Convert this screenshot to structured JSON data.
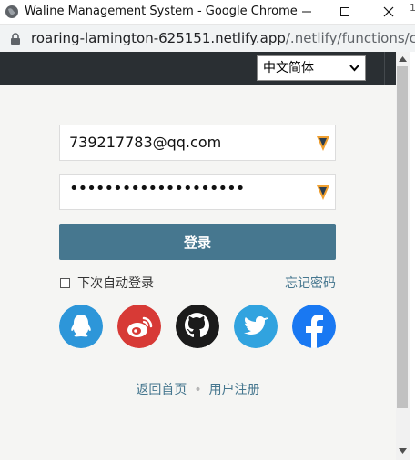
{
  "window": {
    "title": "Waline Management System - Google Chrome",
    "edge_text": "1"
  },
  "address_bar": {
    "url_host": "roaring-lamington-625151.netlify.app",
    "url_path": "/.netlify/functions/c..."
  },
  "header": {
    "language_select": {
      "selected": "中文简体"
    }
  },
  "login_form": {
    "email_value": "739217783@qq.com",
    "password_value": "••••••••••••••••••••",
    "submit_label": "登录",
    "remember_label": "下次自动登录",
    "remember_checked": false,
    "forgot_label": "忘记密码"
  },
  "social_logins": [
    {
      "name": "qq",
      "color": "#2d96d9"
    },
    {
      "name": "weibo",
      "color": "#d73a36"
    },
    {
      "name": "github",
      "color": "#1b1b1b"
    },
    {
      "name": "twitter",
      "color": "#31a3df"
    },
    {
      "name": "facebook",
      "color": "#1978f2"
    }
  ],
  "footer_links": {
    "home_label": "返回首页",
    "separator": "•",
    "register_label": "用户注册"
  },
  "colors": {
    "accent": "#46778f",
    "header_bg": "#2a2f33",
    "page_bg": "#f5f5f3"
  }
}
